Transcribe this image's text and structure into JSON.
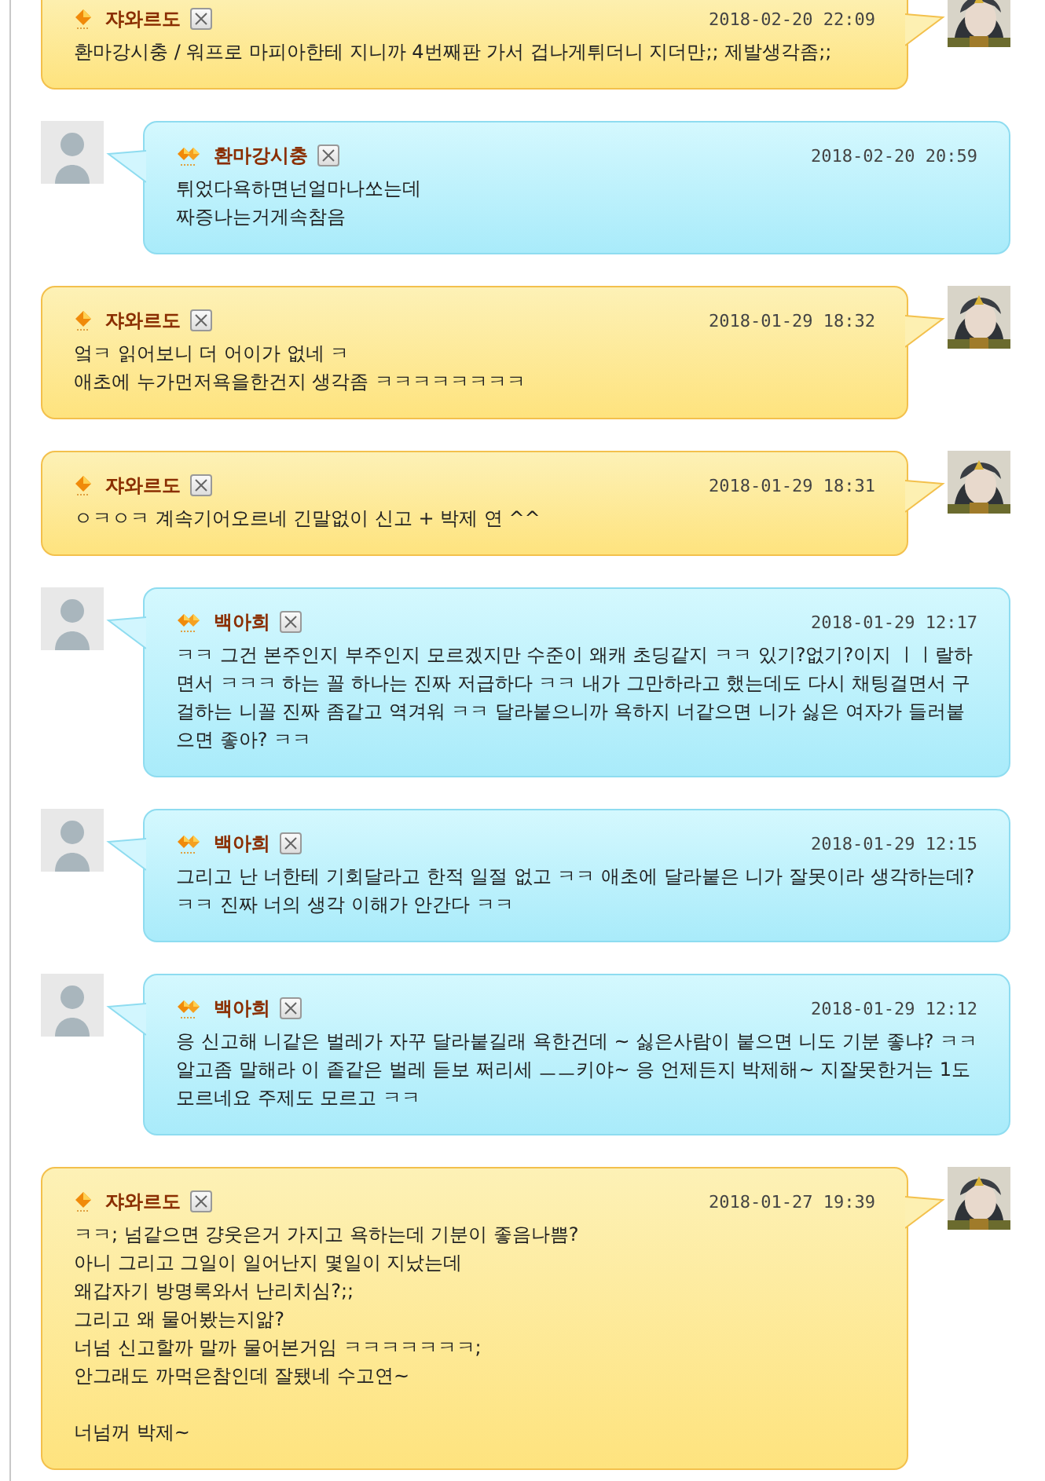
{
  "messages": [
    {
      "kind": "own",
      "author": "쟈와르도",
      "date": "2018-02-20 22:09",
      "body": "환마강시충 / 워프로 마피아한테 지니까 4번째판 가서 겁나게튀더니 지더만;; 제발생각좀;;"
    },
    {
      "kind": "guest",
      "author": "환마강시충",
      "date": "2018-02-20 20:59",
      "body": "튀었다욕하면넌얼마나쏘는데\n짜증나는거게속참음"
    },
    {
      "kind": "own",
      "author": "쟈와르도",
      "date": "2018-01-29 18:32",
      "body": "엌ㅋ 읽어보니 더 어이가 없네 ㅋ\n애초에 누가먼저욕을한건지 생각좀 ㅋㅋㅋㅋㅋㅋㅋㅋ"
    },
    {
      "kind": "own",
      "author": "쟈와르도",
      "date": "2018-01-29 18:31",
      "body": "ㅇㅋㅇㅋ 계속기어오르네 긴말없이 신고 + 박제 연 ^^"
    },
    {
      "kind": "guest",
      "author": "백아희",
      "date": "2018-01-29 12:17",
      "body": "ㅋㅋ 그건 본주인지 부주인지 모르겠지만 수준이 왜캐 초딩같지 ㅋㅋ 있기?없기?이지 ㅣㅣ랄하면서 ㅋㅋㅋ 하는 꼴 하나는 진짜 저급하다 ㅋㅋ 내가 그만하라고 했는데도 다시 채팅걸면서 구걸하는 니꼴 진짜 좀같고 역겨워 ㅋㅋ 달라붙으니까 욕하지 너같으면 니가 싫은 여자가 들러붙으면 좋아? ㅋㅋ"
    },
    {
      "kind": "guest",
      "author": "백아희",
      "date": "2018-01-29 12:15",
      "body": "그리고 난 너한테 기회달라고 한적 일절 없고 ㅋㅋ 애초에 달라붙은 니가 잘못이라 생각하는데? ㅋㅋ 진짜 너의 생각 이해가 안간다 ㅋㅋ"
    },
    {
      "kind": "guest",
      "author": "백아희",
      "date": "2018-01-29 12:12",
      "body": "응 신고해 니같은 벌레가 자꾸 달라붙길래 욕한건데 ~ 싫은사람이 붙으면 니도 기분 좋냐? ㅋㅋ 알고좀 말해라 이 좉같은 벌레 듣보 쩌리세 ㅡㅡ키야~ 응 언제든지 박제해~ 지잘못한거는 1도 모르네요 주제도 모르고 ㅋㅋ"
    },
    {
      "kind": "own",
      "author": "쟈와르도",
      "date": "2018-01-27 19:39",
      "body": "ㅋㅋ; 넘같으면 걍웃은거 가지고 욕하는데 기분이 좋음나쁨?\n아니 그리고 그일이 일어난지 몇일이 지났는데\n왜갑자기 방명록와서 난리치심?;;\n그리고 왜 물어봤는지앎?\n너넘 신고할까 말까 물어본거임 ㅋㅋㅋㅋㅋㅋㅋ;\n안그래도 까먹은참인데 잘됐네 수고연~\n\n너넘꺼 박제~"
    }
  ]
}
